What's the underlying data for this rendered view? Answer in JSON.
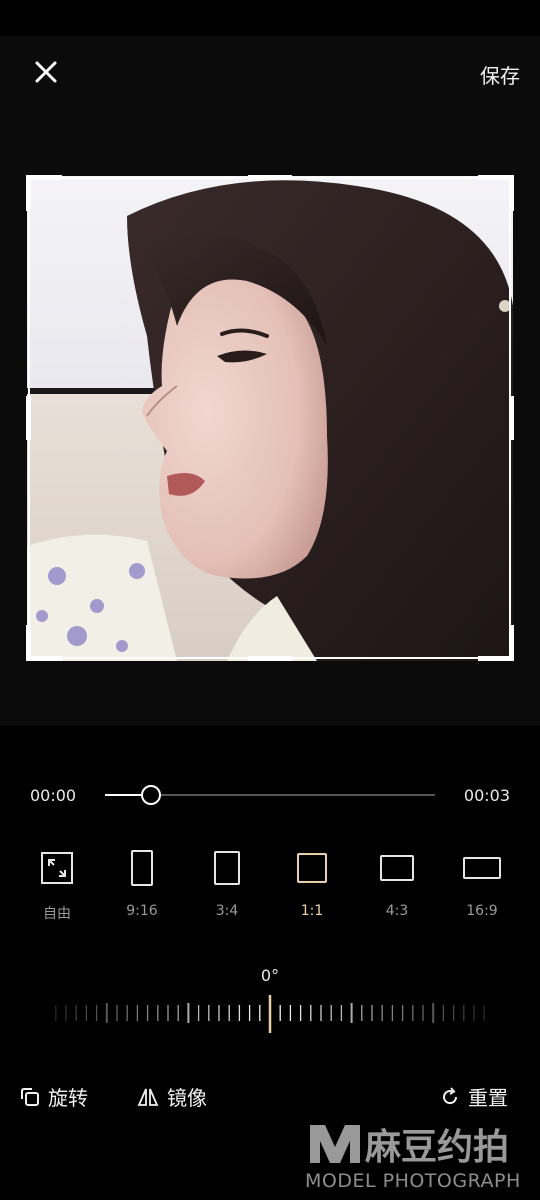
{
  "header": {
    "close_icon": "close-icon",
    "save_label": "保存"
  },
  "editor": {
    "photo_description_icon": "portrait-photo"
  },
  "timeline": {
    "start_time": "00:00",
    "end_time": "00:03",
    "progress": 0.14
  },
  "ratios": {
    "active": "1:1",
    "items": [
      {
        "label": "自由",
        "icon": "free-crop-icon"
      },
      {
        "label": "9:16",
        "icon": "ratio-9-16-icon"
      },
      {
        "label": "3:4",
        "icon": "ratio-3-4-icon"
      },
      {
        "label": "1:1",
        "icon": "ratio-1-1-icon"
      },
      {
        "label": "4:3",
        "icon": "ratio-4-3-icon"
      },
      {
        "label": "16:9",
        "icon": "ratio-16-9-icon"
      }
    ]
  },
  "rotation": {
    "angle_label": "0°",
    "value": 0
  },
  "actions": {
    "rotate_label": "旋转",
    "mirror_label": "镜像",
    "reset_label": "重置"
  },
  "watermark": {
    "brand": "麻豆约拍",
    "sub": "MODEL PHOTOGRAPH"
  },
  "colors": {
    "accent": "#e8d2a8",
    "background": "#000000",
    "panel": "#0b0b0b"
  }
}
